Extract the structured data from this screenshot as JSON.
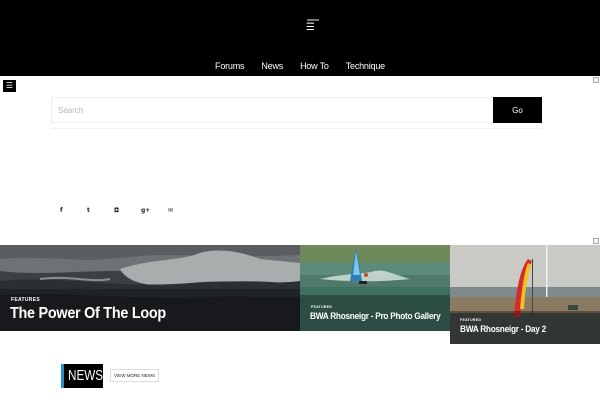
{
  "header": {
    "menu_icon": "hamburger-icon",
    "menu_glyph": "☰",
    "nav": [
      "Forums",
      "News",
      "How To",
      "Technique"
    ]
  },
  "side_menu": {
    "icon": "hamburger-icon",
    "glyph": "☰"
  },
  "search": {
    "placeholder": "Search",
    "value": "",
    "button_label": "Go"
  },
  "social": [
    {
      "icon": "facebook-icon",
      "glyph": "f"
    },
    {
      "icon": "twitter-icon",
      "glyph": "t"
    },
    {
      "icon": "instagram-icon",
      "glyph": "◘"
    },
    {
      "icon": "google-plus-icon",
      "glyph": "g+"
    },
    {
      "icon": "email-icon",
      "glyph": "✉"
    }
  ],
  "features": [
    {
      "category": "Features",
      "title": "The Power Of The Loop"
    },
    {
      "category": "Featured",
      "title": "BWA Rhosneigr - Pro Photo Gallery"
    },
    {
      "category": "Featured",
      "title": "BWA Rhosneigr - Day 2"
    }
  ],
  "news": {
    "heading": "NEWS",
    "view_more_label": "VIEW MORE NEWS"
  },
  "colors": {
    "header_bg": "#000000",
    "accent": "#2a8fc4",
    "page_bg": "#ffffff"
  }
}
